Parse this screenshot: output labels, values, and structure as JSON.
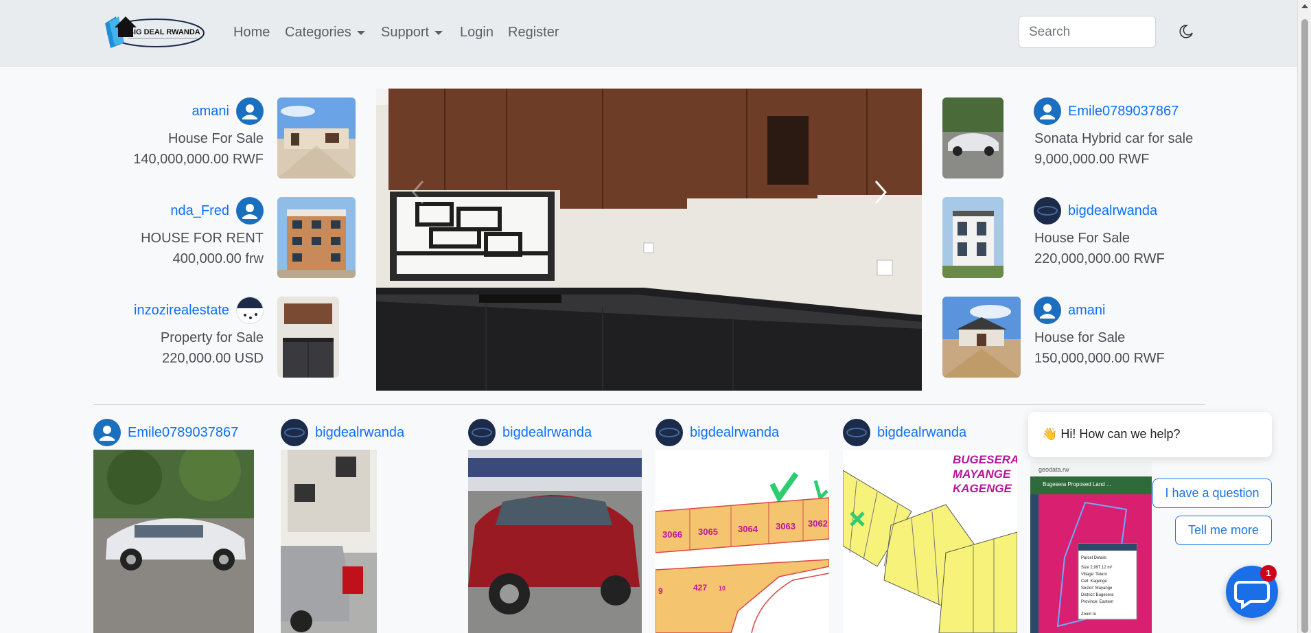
{
  "nav": {
    "logo_text": "BIG DEAL RWANDA",
    "home": "Home",
    "categories": "Categories",
    "support": "Support",
    "login": "Login",
    "register": "Register",
    "search_placeholder": "Search"
  },
  "left_listings": [
    {
      "user": "amani",
      "title": "House For Sale",
      "price": "140,000,000.00 RWF"
    },
    {
      "user": "nda_Fred",
      "title": "HOUSE FOR RENT",
      "price": "400,000.00 frw"
    },
    {
      "user": "inzozirealestate",
      "title": "Property for Sale",
      "price": "220,000.00 USD"
    }
  ],
  "right_listings": [
    {
      "user": "Emile0789037867",
      "title": "Sonata Hybrid car for sale",
      "price": "9,000,000.00 RWF"
    },
    {
      "user": "bigdealrwanda",
      "title": "House For Sale",
      "price": "220,000,000.00 RWF"
    },
    {
      "user": "amani",
      "title": "House for Sale",
      "price": "150,000,000.00 RWF"
    }
  ],
  "grid_cards": [
    {
      "user": "Emile0789037867"
    },
    {
      "user": "bigdealrwanda"
    },
    {
      "user": "bigdealrwanda"
    },
    {
      "user": "bigdealrwanda"
    },
    {
      "user": "bigdealrwanda"
    }
  ],
  "plan_labels": {
    "top": [
      "3066",
      "3065",
      "3064",
      "3063",
      "3062"
    ],
    "bottom": [
      "9",
      "427",
      "10"
    ],
    "bugesera": [
      "BUGESERA",
      "MAYANGE",
      "KAGENGE"
    ]
  },
  "map_card": {
    "site": "geodata.rw",
    "title": "Bugesera Proposed Land ...",
    "panel_title": "Parcel Details",
    "lines": [
      "Size 2,997.12 m²",
      "Village: Tetero",
      "Cell: Kagenge",
      "Sector: Mayange",
      "District: Bugesera",
      "Province: Eastern"
    ],
    "zoom": "Zoom to"
  },
  "chat": {
    "greeting": "👋 Hi! How can we help?",
    "question_btn": "I have a question",
    "more_btn": "Tell me more",
    "badge": "1"
  },
  "colors": {
    "link": "#0d6efd",
    "navbar": "#e9ecef",
    "chat": "#1a73e8"
  }
}
